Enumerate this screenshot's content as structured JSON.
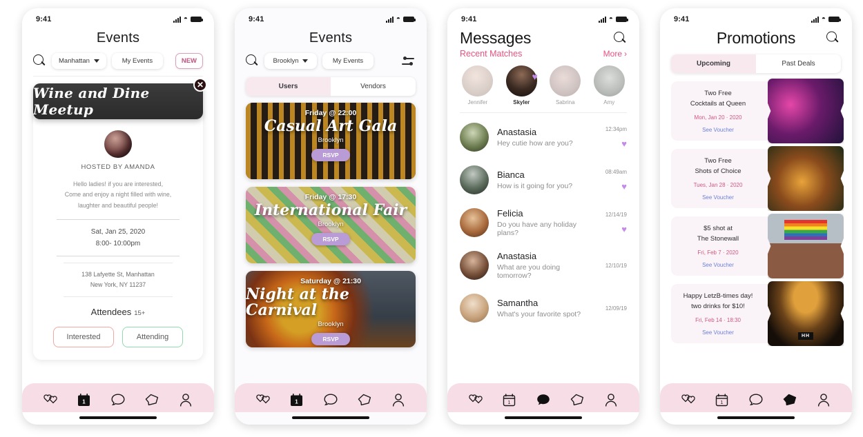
{
  "status_bar": {
    "time": "9:41",
    "signal": "signal-bars",
    "wifi": "wifi-icon",
    "battery": "battery-icon"
  },
  "screens": [
    {
      "id": "events-detail",
      "header": {
        "title": "Events"
      },
      "filters": {
        "search": "search-icon",
        "location": "Manhattan",
        "my_events": "My Events",
        "new_badge": "NEW"
      },
      "event": {
        "banner_title": "Wine and Dine Meetup",
        "close": "✕",
        "host": "HOSTED BY AMANDA",
        "description": "Hello ladies! if you are interested,\nCome and enjoy a night filled with wine,\nlaughter  and beautiful people!",
        "desc_line1": "Hello ladies! if you are interested,",
        "desc_line2": "Come and enjoy a night filled with wine,",
        "desc_line3": "laughter  and beautiful people!",
        "date": "Sat, Jan 25, 2020",
        "time": "8:00- 10:00pm",
        "address_line1": "138 Lafyette St, Manhattan",
        "address_line2": "New York, NY 11237",
        "attendees_label": "Attendees",
        "attendees_count": "15+",
        "btn_interested": "Interested",
        "btn_attending": "Attending"
      },
      "nav_active": "calendar"
    },
    {
      "id": "events-list",
      "header": {
        "title": "Events"
      },
      "filters": {
        "search": "search-icon",
        "location": "Brooklyn",
        "my_events": "My Events",
        "sliders": "sliders-icon"
      },
      "tabs": [
        {
          "label": "Users",
          "active": true
        },
        {
          "label": "Vendors",
          "active": false
        }
      ],
      "cards": [
        {
          "when": "Friday @ 22:00",
          "name": "Casual Art Gala",
          "location": "Brooklyn",
          "rsvp": "RSVP"
        },
        {
          "when": "Friday @ 17:30",
          "name": "International Fair",
          "location": "Brooklyn",
          "rsvp": "RSVP"
        },
        {
          "when": "Saturday @ 21:30",
          "name": "Night at the Carnival",
          "location": "Brooklyn",
          "rsvp": "RSVP"
        }
      ],
      "nav_active": "calendar"
    },
    {
      "id": "messages",
      "header": {
        "title": "Messages",
        "search": "search-icon"
      },
      "recent": {
        "label": "Recent Matches",
        "more": "More",
        "more_chevron": "›"
      },
      "matches": [
        {
          "name": "Jennifer",
          "active": false,
          "heart": false
        },
        {
          "name": "Skyler",
          "active": true,
          "heart": true
        },
        {
          "name": "Sabrina",
          "active": false,
          "heart": false
        },
        {
          "name": "Amy",
          "active": false,
          "heart": false
        }
      ],
      "threads": [
        {
          "name": "Anastasia",
          "preview": "Hey cutie how are you?",
          "time": "12:34pm",
          "heart": true
        },
        {
          "name": "Bianca",
          "preview": "How is it going for you?",
          "time": "08:49am",
          "heart": true
        },
        {
          "name": "Felicia",
          "preview": "Do you have any holiday plans?",
          "time": "12/14/19",
          "heart": true
        },
        {
          "name": "Anastasia",
          "preview": "What are you doing tomorrow?",
          "time": "12/10/19",
          "heart": false
        },
        {
          "name": "Samantha",
          "preview": "What's your favorite spot?",
          "time": "12/09/19",
          "heart": false
        }
      ],
      "nav_active": "messages"
    },
    {
      "id": "promotions",
      "header": {
        "title": "Promotions",
        "search": "search-icon"
      },
      "tabs": [
        {
          "label": "Upcoming",
          "active": true
        },
        {
          "label": "Past Deals",
          "active": false
        }
      ],
      "promotions": [
        {
          "title_line1": "Two Free",
          "title_line2": "Cocktails at Queen",
          "date": "Mon, Jan 20 · 2020",
          "voucher": "See Voucher"
        },
        {
          "title_line1": "Two Free",
          "title_line2": "Shots of Choice",
          "date": "Tues, Jan 28 · 2020",
          "voucher": "See Voucher"
        },
        {
          "title_line1": "$5 shot at",
          "title_line2": "The Stonewall",
          "date": "Fri, Feb 7 · 2020",
          "voucher": "See Voucher"
        },
        {
          "title_line1": "Happy LetzB-times day!",
          "title_line2": "two drinks for $10!",
          "date": "Fri, Feb 14 · 18:30",
          "voucher": "See Voucher"
        }
      ],
      "nav_active": "tickets"
    }
  ],
  "nav_items": [
    {
      "name": "hearts",
      "label": "matches"
    },
    {
      "name": "calendar",
      "label": "events"
    },
    {
      "name": "messages",
      "label": "messages"
    },
    {
      "name": "tickets",
      "label": "promotions"
    },
    {
      "name": "profile",
      "label": "profile"
    }
  ],
  "colors": {
    "nav_bg": "#f7dde6",
    "accent_pink": "#e8517f",
    "tab_active": "#f8e9ef",
    "rsvp": "#b99bd6",
    "promo_bg": "#faf4f8",
    "promo_date": "#d2557e",
    "voucher_link": "#6c7fd8",
    "interested_border": "#f2a8a5",
    "attending_border": "#8fdcb0",
    "new_badge": "#c1537f"
  }
}
